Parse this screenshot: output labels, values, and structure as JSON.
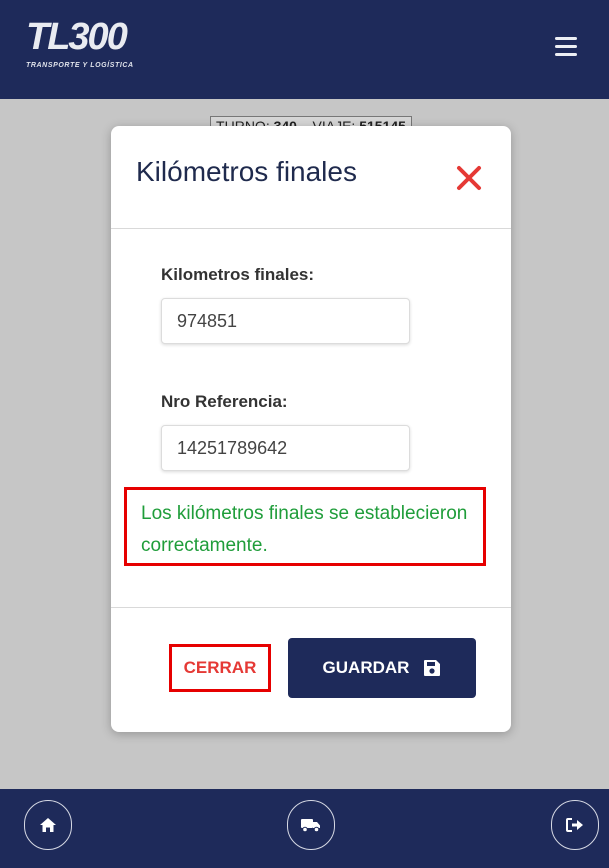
{
  "header": {
    "logo_main": "TL300",
    "logo_sub": "TRANSPORTE Y LOGÍSTICA"
  },
  "background": {
    "turno_label": "TURNO:",
    "turno_value": "340",
    "viaje_label": "VIAJE:",
    "viaje_value": "515145"
  },
  "modal": {
    "title": "Kilómetros finales",
    "km_label": "Kilometros finales:",
    "km_value": "974851",
    "ref_label": "Nro Referencia:",
    "ref_value": "14251789642",
    "success_message": "Los kilómetros finales se establecieron correctamente.",
    "cancel_label": "CERRAR",
    "save_label": "GUARDAR"
  },
  "footer": {
    "icons": [
      "home-icon",
      "truck-icon",
      "logout-icon"
    ]
  },
  "colors": {
    "brand": "#1e2a5a",
    "danger": "#e53935",
    "success": "#1f9d3a",
    "highlight": "#e60000"
  }
}
